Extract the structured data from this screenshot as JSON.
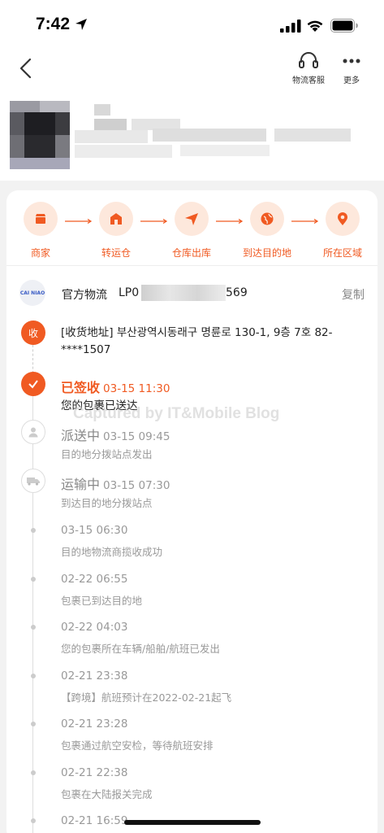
{
  "status_bar": {
    "time": "7:42"
  },
  "nav": {
    "service_label": "物流客服",
    "more_label": "更多"
  },
  "progress_steps": [
    {
      "label": "商家",
      "icon": "store-icon"
    },
    {
      "label": "转运仓",
      "icon": "warehouse-icon"
    },
    {
      "label": "仓库出库",
      "icon": "send-icon"
    },
    {
      "label": "到达目的地",
      "icon": "globe-icon"
    },
    {
      "label": "所在区域",
      "icon": "location-pin-icon"
    }
  ],
  "carrier": {
    "logo_text": "CAI NIAO",
    "name": "官方物流",
    "tracking_prefix": "LP0",
    "tracking_suffix": "569",
    "copy_label": "复制"
  },
  "address": {
    "badge": "收",
    "text": "[收货地址] 부산광역시동래구     명륜로 130-1, 9층 7호 82-****1507"
  },
  "events": [
    {
      "status": "已签收",
      "time": "03-15 11:30",
      "desc": "您的包裹已送达"
    },
    {
      "status": "派送中",
      "time": "03-15 09:45",
      "desc": "目的地分拨站点发出"
    },
    {
      "status": "运输中",
      "time": "03-15 07:30",
      "desc": "到达目的地分拨站点"
    },
    {
      "status": "",
      "time": "03-15 06:30",
      "desc": "目的地物流商揽收成功"
    },
    {
      "status": "",
      "time": "02-22 06:55",
      "desc": "包裹已到达目的地"
    },
    {
      "status": "",
      "time": "02-22 04:03",
      "desc": "您的包裹所在车辆/船舶/航班已发出"
    },
    {
      "status": "",
      "time": "02-21 23:38",
      "desc": "【跨境】航班预计在2022-02-21起飞"
    },
    {
      "status": "",
      "time": "02-21 23:28",
      "desc": "包裹通过航空安检，等待航班安排"
    },
    {
      "status": "",
      "time": "02-21 22:38",
      "desc": "包裹在大陆报关完成"
    },
    {
      "status": "",
      "time": "02-21 16:59",
      "desc": ""
    }
  ],
  "watermark": "Captured by IT&Mobile Blog",
  "colors": {
    "accent": "#f05a22",
    "accent_light": "#fde8dc"
  }
}
